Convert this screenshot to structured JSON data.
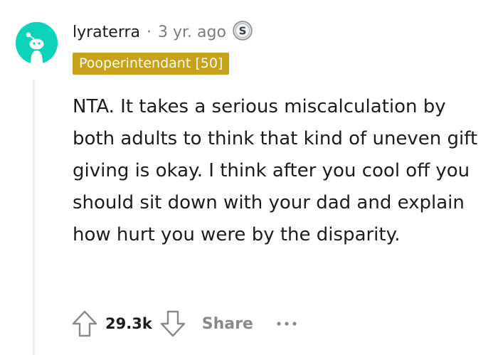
{
  "comment": {
    "author": "lyraterra",
    "separator": "·",
    "age": "3 yr. ago",
    "award_icon": "silver-award-icon",
    "flair": "Pooperintendant [50]",
    "body": "NTA. It takes a serious miscalculation by both adults to think that kind of uneven gift giving is okay. I think after you cool off you should sit down with your dad and explain how hurt you were by the disparity.",
    "score": "29.3k",
    "share_label": "Share"
  },
  "colors": {
    "avatar_bg": "#0dd3bb",
    "flair_bg": "#c8a11a",
    "meta_text": "#7c7c7c",
    "action_text": "#878a8c"
  }
}
